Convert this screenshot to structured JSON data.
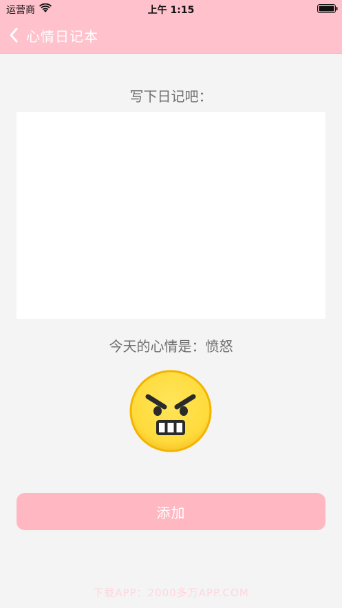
{
  "status_bar": {
    "carrier": "运营商",
    "time": "上午 1:15",
    "icons": [
      "wifi-icon",
      "battery-icon"
    ]
  },
  "nav": {
    "back_icon": "chevron-left-icon",
    "title": "心情日记本"
  },
  "diary": {
    "prompt": "写下日记吧：",
    "value": "",
    "placeholder": ""
  },
  "mood": {
    "label": "今天的心情是：",
    "value": "愤怒",
    "emoji": "angry-face-icon"
  },
  "actions": {
    "add_label": "添加"
  },
  "watermark": "下载APP：2000多万APP.COM",
  "colors": {
    "header_bg": "#ffc1cb",
    "page_bg": "#f4f4f4",
    "button_bg": "#ffb8c2",
    "emoji_fill": "#ffe04a",
    "emoji_outline": "#f3b400"
  }
}
